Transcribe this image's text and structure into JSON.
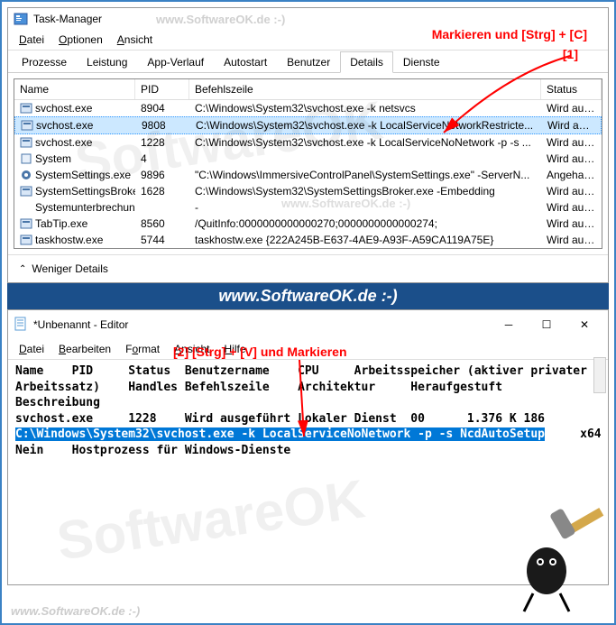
{
  "task_manager": {
    "title": "Task-Manager",
    "watermark": "www.SoftwareOK.de :-)",
    "menu": [
      "Datei",
      "Optionen",
      "Ansicht"
    ],
    "tabs": [
      "Prozesse",
      "Leistung",
      "App-Verlauf",
      "Autostart",
      "Benutzer",
      "Details",
      "Dienste"
    ],
    "active_tab": "Details",
    "columns": {
      "name": "Name",
      "pid": "PID",
      "cmd": "Befehlszeile",
      "status": "Status"
    },
    "rows": [
      {
        "name": "svchost.exe",
        "pid": "8904",
        "cmd": "C:\\Windows\\System32\\svchost.exe -k netsvcs",
        "status": "Wird ausgefüh",
        "selected": false,
        "icon": "svc"
      },
      {
        "name": "svchost.exe",
        "pid": "9808",
        "cmd": "C:\\Windows\\System32\\svchost.exe -k LocalServiceNetworkRestricte...",
        "status": "Wird ausgefüh",
        "selected": true,
        "icon": "svc"
      },
      {
        "name": "svchost.exe",
        "pid": "1228",
        "cmd": "C:\\Windows\\System32\\svchost.exe -k LocalServiceNoNetwork -p -s ...",
        "status": "Wird ausgefüh",
        "selected": false,
        "icon": "svc"
      },
      {
        "name": "System",
        "pid": "4",
        "cmd": "",
        "status": "Wird ausgefüh",
        "selected": false,
        "icon": "sys"
      },
      {
        "name": "SystemSettings.exe",
        "pid": "9896",
        "cmd": "\"C:\\Windows\\ImmersiveControlPanel\\SystemSettings.exe\" -ServerN...",
        "status": "Angehalten",
        "selected": false,
        "icon": "gear"
      },
      {
        "name": "SystemSettingsBroke...",
        "pid": "1628",
        "cmd": "C:\\Windows\\System32\\SystemSettingsBroker.exe -Embedding",
        "status": "Wird ausgefüh",
        "selected": false,
        "icon": "svc"
      },
      {
        "name": "Systemunterbrechun...",
        "pid": "",
        "cmd": "-",
        "status": "Wird ausgefüh",
        "selected": false,
        "icon": "blank"
      },
      {
        "name": "TabTip.exe",
        "pid": "8560",
        "cmd": "/QuitInfo:0000000000000270;0000000000000274;",
        "status": "Wird ausgefüh",
        "selected": false,
        "icon": "svc"
      },
      {
        "name": "taskhostw.exe",
        "pid": "5744",
        "cmd": "taskhostw.exe {222A245B-E637-4AE9-A93F-A59CA119A75E}",
        "status": "Wird ausgefüh",
        "selected": false,
        "icon": "svc"
      }
    ],
    "fewer": "Weniger Details"
  },
  "banner": "www.SoftwareOK.de :-)",
  "notepad": {
    "title": "*Unbenannt - Editor",
    "menu": [
      "Datei",
      "Bearbeiten",
      "Format",
      "Ansicht",
      "Hilfe"
    ],
    "header_line1": "Name    PID     Status  Benutzername    CPU     Arbeitsspeicher (aktiver privater",
    "header_line2": "Arbeitssatz)    Handles Befehlszeile    Architektur     Heraufgestuft",
    "header_line3": "Beschreibung",
    "row_line1": "svchost.exe     1228    Wird ausgeführt Lokaler Dienst  00      1.376 K 186",
    "highlight": "C:\\Windows\\System32\\svchost.exe -k LocalServiceNoNetwork -p -s NcdAutoSetup",
    "row_line2_tail": "     x64",
    "row_line3": "Nein    Hostprozess für Windows-Dienste"
  },
  "annotations": {
    "a1_text": "Markieren und [Strg] + [C]",
    "a1_num": "[1]",
    "a2_text": "[2]  [Strg] + [V] und Markieren"
  },
  "footer_watermark": "www.SoftwareOK.de :-)"
}
